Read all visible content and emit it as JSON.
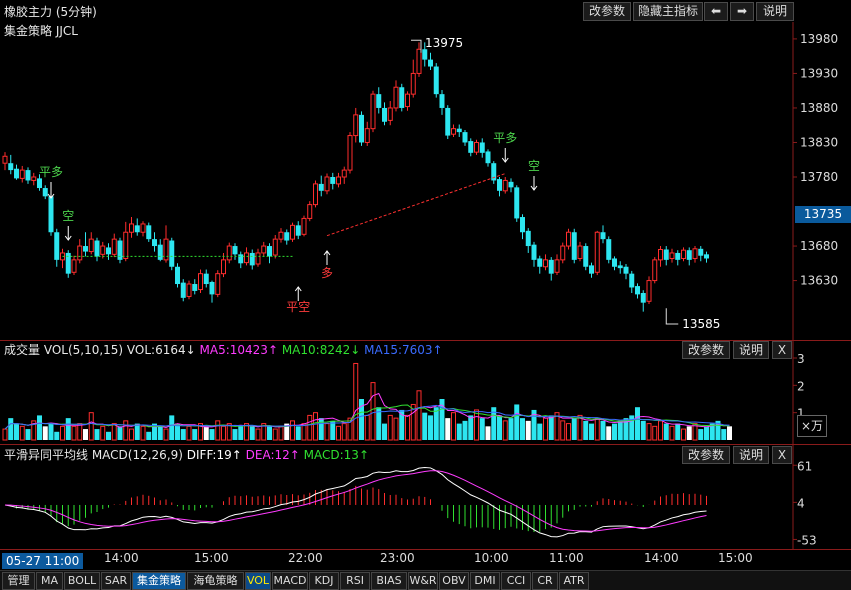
{
  "header": {
    "title": "橡胶主力 (5分钟)",
    "subtitle": "集金策略 JJCL",
    "buttons": [
      "改参数",
      "隐藏主指标",
      "⬅",
      "➡",
      "说明"
    ]
  },
  "main_chart": {
    "price_ticks": [
      "13980",
      "13930",
      "13880",
      "13830",
      "13780",
      "13680",
      "13630"
    ],
    "current_price": "13735",
    "high_label": "13975",
    "low_label": "13585",
    "signals": [
      {
        "text": "平多",
        "color": "#4cd34c"
      },
      {
        "text": "空",
        "color": "#4cd34c"
      },
      {
        "text": "平空",
        "color": "#ff3b3b"
      },
      {
        "text": "多",
        "color": "#ff3b3b"
      },
      {
        "text": "平多",
        "color": "#4cd34c"
      },
      {
        "text": "空",
        "color": "#4cd34c"
      }
    ],
    "colors": {
      "up": "#ff2d2d",
      "down": "#2de6f0",
      "buy_line": "#ff3030",
      "short_line": "#30e030"
    },
    "candles": [
      [
        13800,
        13810,
        13790,
        13816
      ],
      [
        13800,
        13790,
        13784,
        13812
      ],
      [
        13792,
        13778,
        13776,
        13798
      ],
      [
        13778,
        13790,
        13772,
        13796
      ],
      [
        13790,
        13775,
        13770,
        13794
      ],
      [
        13775,
        13780,
        13768,
        13786
      ],
      [
        13778,
        13764,
        13760,
        13784
      ],
      [
        13764,
        13752,
        13748,
        13768
      ],
      [
        13752,
        13700,
        13695,
        13756
      ],
      [
        13700,
        13660,
        13650,
        13705
      ],
      [
        13660,
        13670,
        13648,
        13676
      ],
      [
        13670,
        13640,
        13634,
        13674
      ],
      [
        13642,
        13660,
        13638,
        13666
      ],
      [
        13660,
        13680,
        13655,
        13690
      ],
      [
        13680,
        13672,
        13665,
        13700
      ],
      [
        13672,
        13690,
        13668,
        13700
      ],
      [
        13688,
        13665,
        13658,
        13692
      ],
      [
        13668,
        13680,
        13662,
        13686
      ],
      [
        13678,
        13668,
        13660,
        13684
      ],
      [
        13668,
        13690,
        13664,
        13698
      ],
      [
        13688,
        13660,
        13655,
        13692
      ],
      [
        13662,
        13700,
        13658,
        13715
      ],
      [
        13700,
        13712,
        13692,
        13722
      ],
      [
        13710,
        13700,
        13695,
        13720
      ],
      [
        13700,
        13712,
        13694,
        13716
      ],
      [
        13710,
        13690,
        13686,
        13714
      ],
      [
        13690,
        13680,
        13672,
        13700
      ],
      [
        13682,
        13660,
        13658,
        13690
      ],
      [
        13660,
        13690,
        13656,
        13710
      ],
      [
        13688,
        13650,
        13645,
        13692
      ],
      [
        13650,
        13625,
        13620,
        13655
      ],
      [
        13627,
        13605,
        13600,
        13632
      ],
      [
        13607,
        13625,
        13603,
        13630
      ],
      [
        13625,
        13615,
        13610,
        13632
      ],
      [
        13617,
        13640,
        13612,
        13646
      ],
      [
        13640,
        13625,
        13620,
        13646
      ],
      [
        13628,
        13610,
        13598,
        13630
      ],
      [
        13610,
        13640,
        13606,
        13645
      ],
      [
        13640,
        13660,
        13635,
        13670
      ],
      [
        13660,
        13680,
        13655,
        13685
      ],
      [
        13680,
        13668,
        13660,
        13684
      ],
      [
        13668,
        13655,
        13648,
        13672
      ],
      [
        13656,
        13670,
        13652,
        13678
      ],
      [
        13670,
        13652,
        13646,
        13675
      ],
      [
        13654,
        13670,
        13650,
        13676
      ],
      [
        13670,
        13680,
        13665,
        13686
      ],
      [
        13680,
        13665,
        13655,
        13684
      ],
      [
        13667,
        13690,
        13662,
        13696
      ],
      [
        13690,
        13700,
        13685,
        13706
      ],
      [
        13700,
        13688,
        13682,
        13704
      ],
      [
        13690,
        13710,
        13686,
        13714
      ],
      [
        13710,
        13695,
        13690,
        13716
      ],
      [
        13697,
        13720,
        13694,
        13724
      ],
      [
        13720,
        13740,
        13716,
        13745
      ],
      [
        13740,
        13770,
        13736,
        13775
      ],
      [
        13770,
        13760,
        13752,
        13782
      ],
      [
        13760,
        13780,
        13755,
        13785
      ],
      [
        13780,
        13770,
        13762,
        13786
      ],
      [
        13770,
        13780,
        13765,
        13786
      ],
      [
        13780,
        13790,
        13770,
        13795
      ],
      [
        13790,
        13840,
        13785,
        13845
      ],
      [
        13840,
        13870,
        13830,
        13880
      ],
      [
        13870,
        13830,
        13825,
        13875
      ],
      [
        13830,
        13850,
        13825,
        13860
      ],
      [
        13850,
        13900,
        13845,
        13905
      ],
      [
        13900,
        13880,
        13872,
        13910
      ],
      [
        13880,
        13860,
        13855,
        13888
      ],
      [
        13862,
        13880,
        13855,
        13890
      ],
      [
        13880,
        13910,
        13875,
        13920
      ],
      [
        13910,
        13880,
        13875,
        13915
      ],
      [
        13882,
        13900,
        13876,
        13904
      ],
      [
        13900,
        13930,
        13895,
        13950
      ],
      [
        13930,
        13965,
        13925,
        13975
      ],
      [
        13965,
        13950,
        13940,
        13975
      ],
      [
        13950,
        13940,
        13935,
        13960
      ],
      [
        13940,
        13900,
        13895,
        13945
      ],
      [
        13900,
        13880,
        13870,
        13906
      ],
      [
        13880,
        13840,
        13835,
        13884
      ],
      [
        13842,
        13850,
        13838,
        13856
      ],
      [
        13850,
        13845,
        13838,
        13856
      ],
      [
        13845,
        13830,
        13825,
        13848
      ],
      [
        13832,
        13815,
        13810,
        13836
      ],
      [
        13816,
        13830,
        13812,
        13834
      ],
      [
        13830,
        13815,
        13808,
        13836
      ],
      [
        13817,
        13800,
        13795,
        13820
      ],
      [
        13800,
        13775,
        13770,
        13803
      ],
      [
        13777,
        13760,
        13752,
        13780
      ],
      [
        13760,
        13775,
        13756,
        13780
      ],
      [
        13773,
        13765,
        13758,
        13778
      ],
      [
        13765,
        13720,
        13715,
        13768
      ],
      [
        13722,
        13700,
        13690,
        13726
      ],
      [
        13702,
        13680,
        13670,
        13706
      ],
      [
        13682,
        13660,
        13650,
        13686
      ],
      [
        13662,
        13650,
        13640,
        13666
      ],
      [
        13650,
        13660,
        13645,
        13668
      ],
      [
        13660,
        13640,
        13630,
        13664
      ],
      [
        13642,
        13660,
        13638,
        13668
      ],
      [
        13660,
        13680,
        13655,
        13685
      ],
      [
        13680,
        13700,
        13675,
        13705
      ],
      [
        13700,
        13660,
        13655,
        13705
      ],
      [
        13662,
        13680,
        13658,
        13686
      ],
      [
        13680,
        13650,
        13645,
        13684
      ],
      [
        13652,
        13640,
        13634,
        13656
      ],
      [
        13642,
        13700,
        13638,
        13702
      ],
      [
        13700,
        13690,
        13684,
        13710
      ],
      [
        13690,
        13660,
        13655,
        13694
      ],
      [
        13662,
        13650,
        13645,
        13665
      ],
      [
        13652,
        13648,
        13640,
        13658
      ],
      [
        13650,
        13640,
        13632,
        13654
      ],
      [
        13640,
        13620,
        13612,
        13644
      ],
      [
        13622,
        13610,
        13604,
        13626
      ],
      [
        13612,
        13598,
        13585,
        13616
      ],
      [
        13600,
        13630,
        13596,
        13636
      ],
      [
        13630,
        13660,
        13626,
        13664
      ],
      [
        13660,
        13675,
        13650,
        13680
      ],
      [
        13675,
        13660,
        13652,
        13680
      ],
      [
        13662,
        13670,
        13656,
        13676
      ],
      [
        13670,
        13660,
        13652,
        13674
      ],
      [
        13662,
        13674,
        13658,
        13678
      ],
      [
        13674,
        13660,
        13652,
        13678
      ],
      [
        13662,
        13676,
        13656,
        13680
      ],
      [
        13676,
        13666,
        13658,
        13680
      ],
      [
        13668,
        13662,
        13656,
        13672
      ]
    ]
  },
  "vol_panel": {
    "title": "成交量 VOL(5,10,15) VOL:6164↓",
    "ma5": "MA5:10423↑",
    "ma10": "MA10:8242↓",
    "ma15": "MA15:7603↑",
    "buttons": [
      "改参数",
      "说明"
    ],
    "close_icon": "X",
    "ticks": [
      "3",
      "2",
      "1"
    ],
    "unit": "×万",
    "volumes": [
      0.4,
      0.8,
      0.6,
      0.5,
      0.4,
      0.7,
      0.9,
      0.5,
      0.6,
      0.3,
      0.5,
      0.8,
      0.5,
      0.6,
      0.4,
      1.0,
      0.4,
      0.5,
      0.3,
      0.6,
      0.5,
      0.7,
      0.4,
      0.6,
      0.5,
      0.3,
      0.6,
      0.5,
      0.4,
      0.9,
      0.6,
      0.4,
      0.5,
      0.4,
      0.6,
      0.5,
      0.4,
      0.7,
      0.5,
      0.6,
      0.4,
      0.5,
      0.6,
      0.5,
      0.4,
      0.6,
      0.5,
      0.4,
      0.5,
      0.6,
      0.7,
      0.5,
      0.6,
      0.9,
      1.0,
      0.8,
      0.6,
      0.7,
      0.5,
      0.6,
      0.8,
      2.8,
      1.5,
      0.9,
      2.1,
      1.2,
      0.6,
      0.9,
      0.8,
      1.1,
      0.9,
      1.3,
      1.8,
      1.0,
      0.9,
      1.2,
      1.5,
      0.8,
      1.0,
      0.6,
      0.7,
      0.9,
      1.1,
      0.8,
      0.5,
      1.2,
      0.9,
      0.7,
      0.8,
      1.3,
      0.8,
      0.7,
      1.1,
      0.6,
      0.8,
      0.9,
      1.0,
      0.7,
      0.6,
      0.8,
      0.9,
      0.7,
      0.6,
      0.8,
      0.7,
      0.5,
      0.6,
      0.7,
      0.8,
      0.9,
      1.2,
      0.7,
      0.6,
      0.5,
      0.7,
      0.6,
      0.5,
      0.6,
      0.4,
      0.5,
      0.6,
      0.4,
      0.5,
      0.6,
      0.7,
      0.4,
      0.5
    ]
  },
  "macd_panel": {
    "title": "平滑异同平均线 MACD(12,26,9)",
    "diff": "DIFF:19↑",
    "dea": "DEA:12↑",
    "macd": "MACD:13↑",
    "buttons": [
      "改参数",
      "说明"
    ],
    "close_icon": "X",
    "ticks": [
      "61",
      "4",
      "-53"
    ],
    "y_range": [
      -60,
      66
    ]
  },
  "time_axis": {
    "cursor_label": "05-27 11:00",
    "labels": [
      "14:00",
      "15:00",
      "22:00",
      "23:00",
      "10:00",
      "11:00",
      "14:00",
      "15:00"
    ]
  },
  "bottom_tabs": [
    {
      "label": "管理",
      "state": "normal"
    },
    {
      "label": "MA",
      "state": "normal"
    },
    {
      "label": "BOLL",
      "state": "normal"
    },
    {
      "label": "SAR",
      "state": "normal"
    },
    {
      "label": "集金策略",
      "state": "selected"
    },
    {
      "label": "海龟策略",
      "state": "normal"
    },
    {
      "label": "VOL",
      "state": "vol"
    },
    {
      "label": "MACD",
      "state": "normal"
    },
    {
      "label": "KDJ",
      "state": "normal"
    },
    {
      "label": "RSI",
      "state": "normal"
    },
    {
      "label": "BIAS",
      "state": "normal"
    },
    {
      "label": "W&R",
      "state": "normal"
    },
    {
      "label": "OBV",
      "state": "normal"
    },
    {
      "label": "DMI",
      "state": "normal"
    },
    {
      "label": "CCI",
      "state": "normal"
    },
    {
      "label": "CR",
      "state": "normal"
    },
    {
      "label": "ATR",
      "state": "normal"
    }
  ]
}
